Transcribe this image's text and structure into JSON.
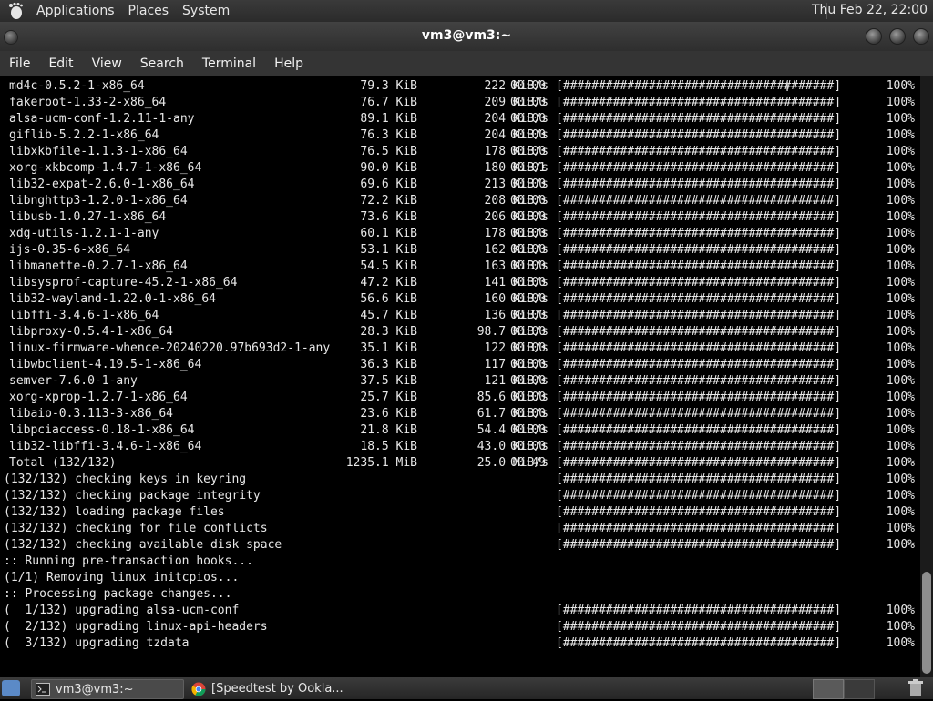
{
  "top_panel": {
    "menus": [
      "Applications",
      "Places",
      "System"
    ],
    "clock": "Thu Feb 22, 22:00"
  },
  "window": {
    "title": "vm3@vm3:~"
  },
  "menubar": [
    "File",
    "Edit",
    "View",
    "Search",
    "Terminal",
    "Help"
  ],
  "terminal": {
    "downloads": [
      {
        "name": "md4c-0.5.2-1-x86_64",
        "size": "79.3 KiB",
        "rate": "222 KiB/s",
        "time": "00:00",
        "bar": "[######################################]",
        "pct": "100%"
      },
      {
        "name": "fakeroot-1.33-2-x86_64",
        "size": "76.7 KiB",
        "rate": "209 KiB/s",
        "time": "00:00",
        "bar": "[######################################]",
        "pct": "100%"
      },
      {
        "name": "alsa-ucm-conf-1.2.11-1-any",
        "size": "89.1 KiB",
        "rate": "204 KiB/s",
        "time": "00:00",
        "bar": "[######################################]",
        "pct": "100%"
      },
      {
        "name": "giflib-5.2.2-1-x86_64",
        "size": "76.3 KiB",
        "rate": "204 KiB/s",
        "time": "00:00",
        "bar": "[######################################]",
        "pct": "100%"
      },
      {
        "name": "libxkbfile-1.1.3-1-x86_64",
        "size": "76.5 KiB",
        "rate": "178 KiB/s",
        "time": "00:00",
        "bar": "[######################################]",
        "pct": "100%"
      },
      {
        "name": "xorg-xkbcomp-1.4.7-1-x86_64",
        "size": "90.0 KiB",
        "rate": "180 KiB/s",
        "time": "00:01",
        "bar": "[######################################]",
        "pct": "100%"
      },
      {
        "name": "lib32-expat-2.6.0-1-x86_64",
        "size": "69.6 KiB",
        "rate": "213 KiB/s",
        "time": "00:00",
        "bar": "[######################################]",
        "pct": "100%"
      },
      {
        "name": "libnghttp3-1.2.0-1-x86_64",
        "size": "72.2 KiB",
        "rate": "208 KiB/s",
        "time": "00:00",
        "bar": "[######################################]",
        "pct": "100%"
      },
      {
        "name": "libusb-1.0.27-1-x86_64",
        "size": "73.6 KiB",
        "rate": "206 KiB/s",
        "time": "00:00",
        "bar": "[######################################]",
        "pct": "100%"
      },
      {
        "name": "xdg-utils-1.2.1-1-any",
        "size": "60.1 KiB",
        "rate": "178 KiB/s",
        "time": "00:00",
        "bar": "[######################################]",
        "pct": "100%"
      },
      {
        "name": "ijs-0.35-6-x86_64",
        "size": "53.1 KiB",
        "rate": "162 KiB/s",
        "time": "00:00",
        "bar": "[######################################]",
        "pct": "100%"
      },
      {
        "name": "libmanette-0.2.7-1-x86_64",
        "size": "54.5 KiB",
        "rate": "163 KiB/s",
        "time": "00:00",
        "bar": "[######################################]",
        "pct": "100%"
      },
      {
        "name": "libsysprof-capture-45.2-1-x86_64",
        "size": "47.2 KiB",
        "rate": "141 KiB/s",
        "time": "00:00",
        "bar": "[######################################]",
        "pct": "100%"
      },
      {
        "name": "lib32-wayland-1.22.0-1-x86_64",
        "size": "56.6 KiB",
        "rate": "160 KiB/s",
        "time": "00:00",
        "bar": "[######################################]",
        "pct": "100%"
      },
      {
        "name": "libffi-3.4.6-1-x86_64",
        "size": "45.7 KiB",
        "rate": "136 KiB/s",
        "time": "00:00",
        "bar": "[######################################]",
        "pct": "100%"
      },
      {
        "name": "libproxy-0.5.4-1-x86_64",
        "size": "28.3 KiB",
        "rate": "98.7 KiB/s",
        "time": "00:00",
        "bar": "[######################################]",
        "pct": "100%"
      },
      {
        "name": "linux-firmware-whence-20240220.97b693d2-1-any",
        "size": "35.1 KiB",
        "rate": "122 KiB/s",
        "time": "00:00",
        "bar": "[######################################]",
        "pct": "100%"
      },
      {
        "name": "libwbclient-4.19.5-1-x86_64",
        "size": "36.3 KiB",
        "rate": "117 KiB/s",
        "time": "00:00",
        "bar": "[######################################]",
        "pct": "100%"
      },
      {
        "name": "semver-7.6.0-1-any",
        "size": "37.5 KiB",
        "rate": "121 KiB/s",
        "time": "00:00",
        "bar": "[######################################]",
        "pct": "100%"
      },
      {
        "name": "xorg-xprop-1.2.7-1-x86_64",
        "size": "25.7 KiB",
        "rate": "85.6 KiB/s",
        "time": "00:00",
        "bar": "[######################################]",
        "pct": "100%"
      },
      {
        "name": "libaio-0.3.113-3-x86_64",
        "size": "23.6 KiB",
        "rate": "61.7 KiB/s",
        "time": "00:00",
        "bar": "[######################################]",
        "pct": "100%"
      },
      {
        "name": "libpciaccess-0.18-1-x86_64",
        "size": "21.8 KiB",
        "rate": "54.4 KiB/s",
        "time": "00:00",
        "bar": "[######################################]",
        "pct": "100%"
      },
      {
        "name": "lib32-libffi-3.4.6-1-x86_64",
        "size": "18.5 KiB",
        "rate": "43.0 KiB/s",
        "time": "00:00",
        "bar": "[######################################]",
        "pct": "100%"
      },
      {
        "name": "Total (132/132)",
        "size": "1235.1 MiB",
        "rate": "25.0 MiB/s",
        "time": "00:49",
        "bar": "[######################################]",
        "pct": "100%"
      }
    ],
    "steps": [
      {
        "text": "(132/132) checking keys in keyring",
        "bar": "[######################################]",
        "pct": "100%"
      },
      {
        "text": "(132/132) checking package integrity",
        "bar": "[######################################]",
        "pct": "100%"
      },
      {
        "text": "(132/132) loading package files",
        "bar": "[######################################]",
        "pct": "100%"
      },
      {
        "text": "(132/132) checking for file conflicts",
        "bar": "[######################################]",
        "pct": "100%"
      },
      {
        "text": "(132/132) checking available disk space",
        "bar": "[######################################]",
        "pct": "100%"
      },
      {
        "text": ":: Running pre-transaction hooks...",
        "bar": "",
        "pct": ""
      },
      {
        "text": "(1/1) Removing linux initcpios...",
        "bar": "",
        "pct": ""
      },
      {
        "text": ":: Processing package changes...",
        "bar": "",
        "pct": ""
      },
      {
        "text": "(  1/132) upgrading alsa-ucm-conf",
        "bar": "[######################################]",
        "pct": "100%"
      },
      {
        "text": "(  2/132) upgrading linux-api-headers",
        "bar": "[######################################]",
        "pct": "100%"
      },
      {
        "text": "(  3/132) upgrading tzdata",
        "bar": "[######################################]",
        "pct": "100%"
      }
    ]
  },
  "taskbar": {
    "tasks": [
      {
        "label": "vm3@vm3:~",
        "icon": "terminal-icon"
      },
      {
        "label": "[Speedtest by Ookla...",
        "icon": "chrome-icon"
      }
    ]
  }
}
